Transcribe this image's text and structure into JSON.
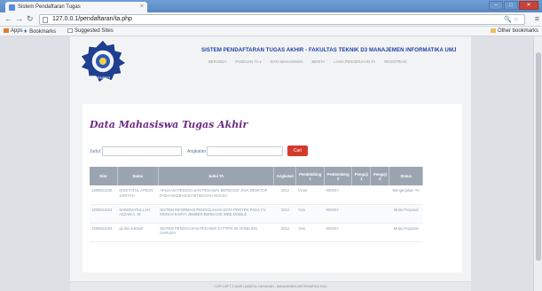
{
  "browser": {
    "tab_title": "Sistem Pendaftaran Tugas",
    "url": "127.0.0.1/pendaftaran/ta.php",
    "bookmarks": [
      "Apps",
      "Bookmarks",
      "Suggested Sites"
    ],
    "other_bookmarks": "Other bookmarks"
  },
  "site": {
    "title": "SISTEM PENDAFTARAN TUGAS AKHIR - FAKULTAS TEKNIK D3 MANAJEMEN INFORMATIKA UMJ",
    "nav": [
      "BERANDA",
      "PANDUAN TA ▾",
      "DATA MAHASISWA",
      "BERITA",
      "LAMA PENGERJAAN TA",
      "REGISTRASI"
    ],
    "logo_text": "FAKULTAS MUHAMMADIYAH JEMBER"
  },
  "main": {
    "heading": "Data Mahasiswa Tugas Akhir",
    "search": {
      "judul_label": "Judul TA",
      "angkatan_label": "Angkatan",
      "button": "Cari"
    },
    "table": {
      "headers": [
        "Nim",
        "Nama",
        "Judul TA",
        "Angkatan",
        "Pembimbing 1",
        "Pembimbing 2",
        "Penguji 1",
        "Penguji 2",
        "Status"
      ],
      "rows": [
        [
          "1200631030",
          "NADIYATUL AYNUN JARIYAH",
          "APLIKASI PENGGAJIAN PEGAWAI BERBASIS JAVA DESKTOP PADA MADRASAH IBTIDAIYAH MUASA",
          "2012",
          "Victor",
          "HENNY",
          "",
          "",
          "Mengerjakan TA"
        ],
        [
          "1200631024",
          "SHIBGHATULLAH AZZAM A. M.",
          "SISTEM INFORMASI PENGOLAHAN DATA PROYEK PADA CV. MONAS KARYA JEMBER BERBASIS WEB MOBILE",
          "2012",
          "Yani",
          "HENNY",
          "",
          "",
          "Mulai Proposal"
        ],
        [
          "1200631034",
          "aji dwi sukmalr",
          "SISTEM PENGGAJIAN PEGAWAI DI PTPN XII AFDELING GARUDA",
          "2012",
          "Yani",
          "HENNY",
          "",
          "",
          "Mulai Proposal"
        ]
      ]
    }
  },
  "footer": {
    "text": "COPYLEFT © ANIS LAMATUL HASANAH - MANAJEMEN INFORMATIKA 2015"
  },
  "colors": {
    "heading": "#6b2a84",
    "site_title": "#1a3fa8",
    "cari_button": "#d43a2c",
    "table_header": "#9aa5b0",
    "status": "#c2571f"
  }
}
